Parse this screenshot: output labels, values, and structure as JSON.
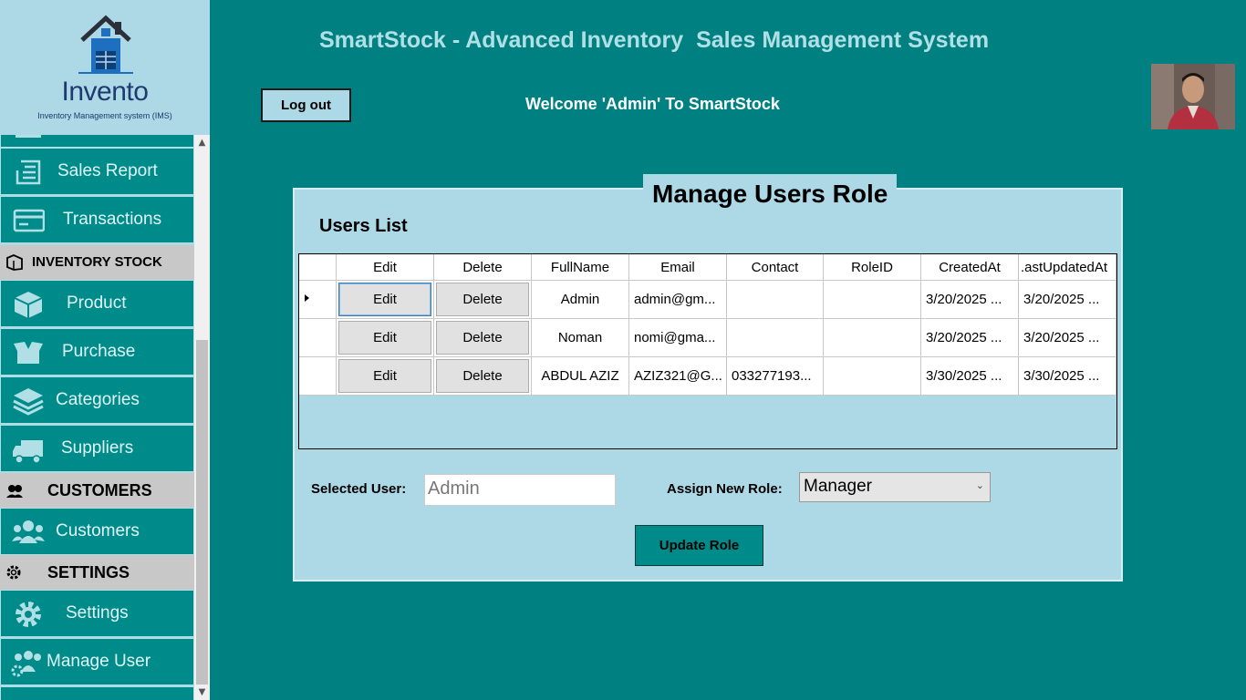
{
  "app": {
    "title": "SmartStock - Advanced Inventory  Sales Management System",
    "welcome": "Welcome 'Admin' To SmartStock",
    "logout_label": "Log out"
  },
  "logo": {
    "title": "Invento",
    "subtitle": "Inventory Management system (IMS)"
  },
  "sidebar": {
    "items": [
      {
        "label": "Sales Report",
        "icon": "report-icon"
      },
      {
        "label": "Transactions",
        "icon": "card-icon"
      },
      {
        "label": "INVENTORY  STOCK",
        "icon": "box-tag-icon",
        "header": true
      },
      {
        "label": "Product",
        "icon": "cube-icon"
      },
      {
        "label": "Purchase",
        "icon": "open-box-icon"
      },
      {
        "label": "Categories",
        "icon": "layers-icon"
      },
      {
        "label": "Suppliers",
        "icon": "truck-icon"
      },
      {
        "label": "CUSTOMERS",
        "icon": "customers-head-icon",
        "header": true
      },
      {
        "label": "Customers",
        "icon": "group-icon"
      },
      {
        "label": "SETTINGS",
        "icon": "gear-small-icon",
        "header": true
      },
      {
        "label": "Settings",
        "icon": "gear-icon"
      },
      {
        "label": "Manage User",
        "icon": "user-gear-icon"
      }
    ]
  },
  "panel": {
    "title": "Manage Users Role",
    "list_title": "Users List"
  },
  "grid": {
    "columns": [
      "Edit",
      "Delete",
      "FullName",
      "Email",
      "Contact",
      "RoleID",
      "CreatedAt",
      ".astUpdatedAt"
    ],
    "rows": [
      {
        "edit": "Edit",
        "delete": "Delete",
        "fullname": "Admin",
        "email": "admin@gm...",
        "contact": "",
        "roleid": "",
        "created": "3/20/2025 ...",
        "updated": "3/20/2025 ..."
      },
      {
        "edit": "Edit",
        "delete": "Delete",
        "fullname": "Noman",
        "email": "nomi@gma...",
        "contact": "",
        "roleid": "",
        "created": "3/20/2025 ...",
        "updated": "3/20/2025 ..."
      },
      {
        "edit": "Edit",
        "delete": "Delete",
        "fullname": "ABDUL AZIZ",
        "email": "AZIZ321@G...",
        "contact": "033277193...",
        "roleid": "",
        "created": "3/30/2025 ...",
        "updated": "3/30/2025 ..."
      }
    ]
  },
  "form": {
    "selected_label": "Selected User:",
    "selected_value": "Admin",
    "role_label": "Assign New Role:",
    "role_value": "Manager",
    "update_label": "Update Role"
  },
  "colors": {
    "background": "#008080",
    "panel": "#add8e6",
    "nav_item": "#008b8b",
    "nav_header": "#c8c8c8"
  }
}
